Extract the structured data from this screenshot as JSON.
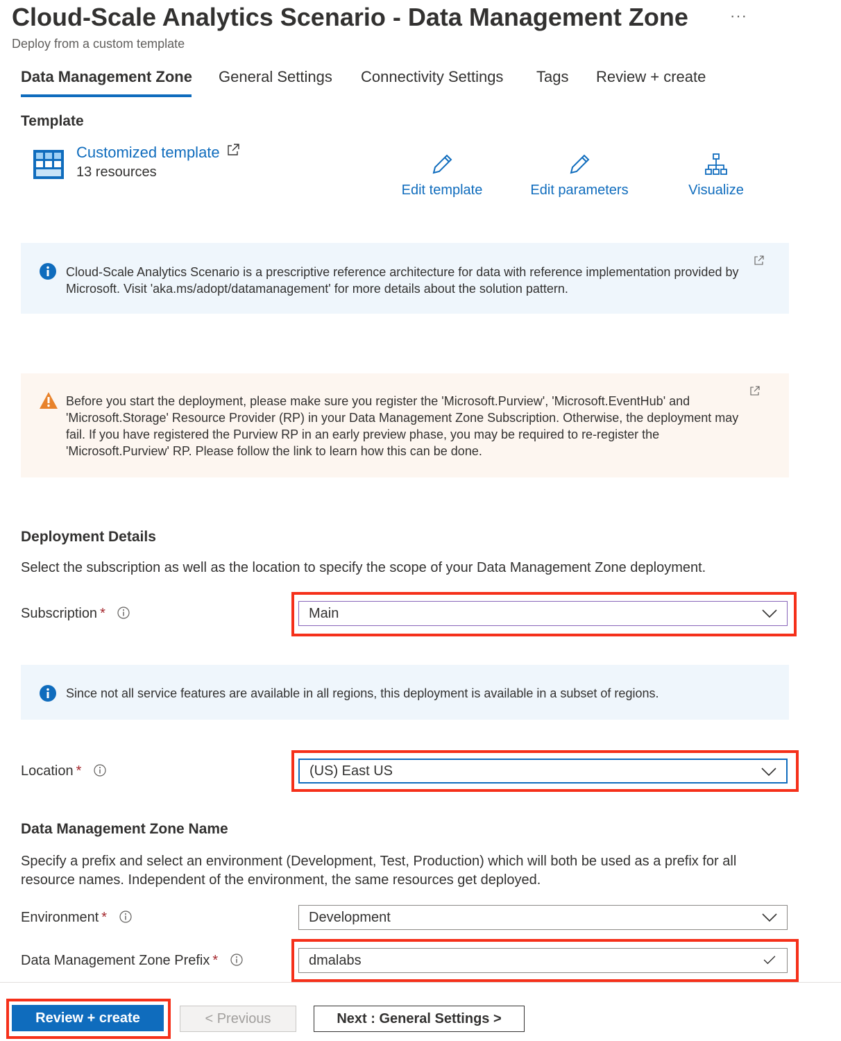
{
  "header": {
    "title": "Cloud-Scale Analytics Scenario - Data Management Zone",
    "more_label": "···",
    "subtitle": "Deploy from a custom template"
  },
  "tabs": [
    {
      "label": "Data Management Zone",
      "active": true
    },
    {
      "label": "General Settings",
      "active": false
    },
    {
      "label": "Connectivity Settings",
      "active": false
    },
    {
      "label": "Tags",
      "active": false
    },
    {
      "label": "Review + create",
      "active": false
    }
  ],
  "template": {
    "heading": "Template",
    "link_label": "Customized template",
    "resources": "13 resources",
    "actions": {
      "edit_template": "Edit template",
      "edit_parameters": "Edit parameters",
      "visualize": "Visualize"
    }
  },
  "info_banner": {
    "text": "Cloud-Scale Analytics Scenario is a prescriptive reference architecture for data with reference implementation provided by Microsoft. Visit 'aka.ms/adopt/datamanagement' for more details about the solution pattern."
  },
  "warning_banner": {
    "text": "Before you start the deployment, please make sure you register the 'Microsoft.Purview', 'Microsoft.EventHub' and 'Microsoft.Storage' Resource Provider (RP) in your Data Management Zone Subscription. Otherwise, the deployment may fail. If you have registered the Purview RP in an early preview phase, you may be required to re-register the 'Microsoft.Purview' RP. Please follow the link to learn how this can be done."
  },
  "deployment": {
    "heading": "Deployment Details",
    "description": "Select the subscription as well as the location to specify the scope of your Data Management Zone deployment.",
    "subscription_label": "Subscription",
    "subscription_value": "Main",
    "regions_note": "Since not all service features are available in all regions, this deployment is available in a subset of regions.",
    "location_label": "Location",
    "location_value": "(US) East US"
  },
  "dmz_name": {
    "heading": "Data Management Zone Name",
    "description": "Specify a prefix and select an environment (Development, Test, Production) which will both be used as a prefix for all resource names. Independent of the environment, the same resources get deployed.",
    "environment_label": "Environment",
    "environment_value": "Development",
    "prefix_label": "Data Management Zone Prefix",
    "prefix_value": "dmalabs"
  },
  "required_mark": "*",
  "footer": {
    "review_create": "Review + create",
    "previous": "< Previous",
    "next": "Next : General Settings >"
  },
  "colors": {
    "accent": "#0f6cbd",
    "highlight": "#f5301a",
    "warning_icon": "#e8822b",
    "info_bg": "#eff6fc",
    "warn_bg": "#fdf6f0"
  }
}
